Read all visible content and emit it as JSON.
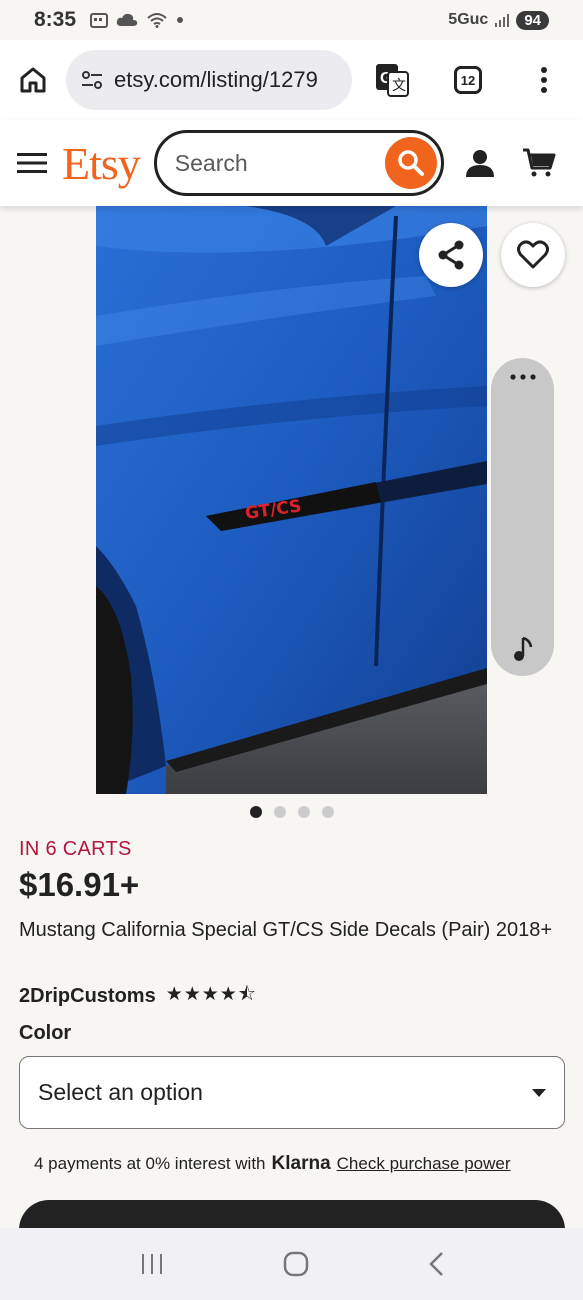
{
  "status_bar": {
    "time": "8:35",
    "network": "5Guc",
    "battery": "94"
  },
  "browser": {
    "url": "etsy.com/listing/1279",
    "tab_count": "12"
  },
  "header": {
    "logo": "Etsy",
    "search_placeholder": "Search"
  },
  "gallery": {
    "image_count": 4,
    "active_index": 0,
    "decal_text": "GT/CS"
  },
  "product": {
    "carts_label": "IN 6 CARTS",
    "price": "$16.91+",
    "title": "Mustang California Special GT/CS Side Decals (Pair) 2018+",
    "shop_name": "2DripCustoms",
    "rating_stars": "★★★★⯪",
    "color_label": "Color",
    "color_select_value": "Select an option"
  },
  "klarna": {
    "text": "4 payments at 0% interest with",
    "brand": "Klarna",
    "link": "Check purchase power"
  },
  "colors": {
    "etsy_orange": "#f1641e",
    "carts_red": "#b3173e",
    "car_blue": "#1d5bbf"
  }
}
